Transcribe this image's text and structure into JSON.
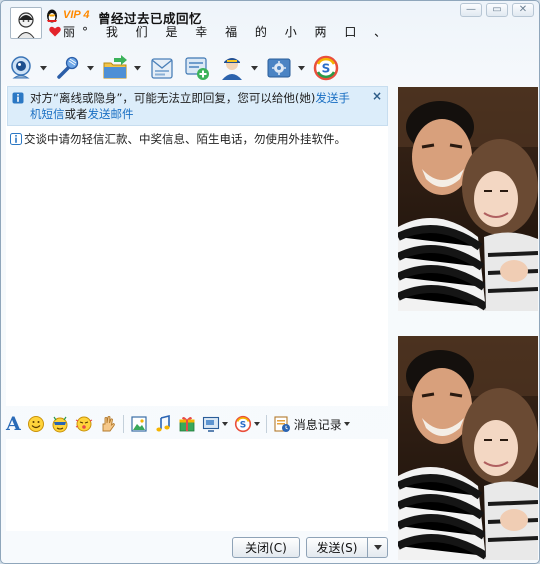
{
  "window": {
    "contact_name": "曾经过去已成回忆",
    "vip_badge": "VIP 4",
    "signature": "丽° 我 们 是 幸 福 的 小 两 口 、",
    "controls": {
      "minimize": "—",
      "maximize": "▭",
      "close": "✕"
    }
  },
  "toolbar": {
    "items": [
      {
        "icon": "webcam-icon",
        "has_dropdown": true
      },
      {
        "icon": "microphone-icon",
        "has_dropdown": true
      },
      {
        "icon": "send-file-icon",
        "has_dropdown": true
      },
      {
        "icon": "send-sms-icon",
        "has_dropdown": false
      },
      {
        "icon": "create-group-icon",
        "has_dropdown": false
      },
      {
        "icon": "remote-assist-icon",
        "has_dropdown": true
      },
      {
        "icon": "app-center-icon",
        "has_dropdown": true
      },
      {
        "icon": "soso-icon",
        "has_dropdown": false
      }
    ]
  },
  "chat": {
    "notice": {
      "text_before": "对方“离线或隐身”，可能无法立即回复，您可以给他(她)",
      "link_sms": "发送手机短信",
      "text_middle": "或者",
      "link_email": "发送邮件",
      "close": "×"
    },
    "warning": "交谈中请勿轻信汇款、中奖信息、陌生电话，勿使用外挂软件。"
  },
  "input_toolbar": {
    "font_label": "A",
    "history_label": "消息记录"
  },
  "buttons": {
    "close": "关闭(C)",
    "send": "发送(S)"
  },
  "colors": {
    "accent": "#1a6fc3",
    "notice_bg": "#dcedfa",
    "vip": "#ff8a00"
  }
}
